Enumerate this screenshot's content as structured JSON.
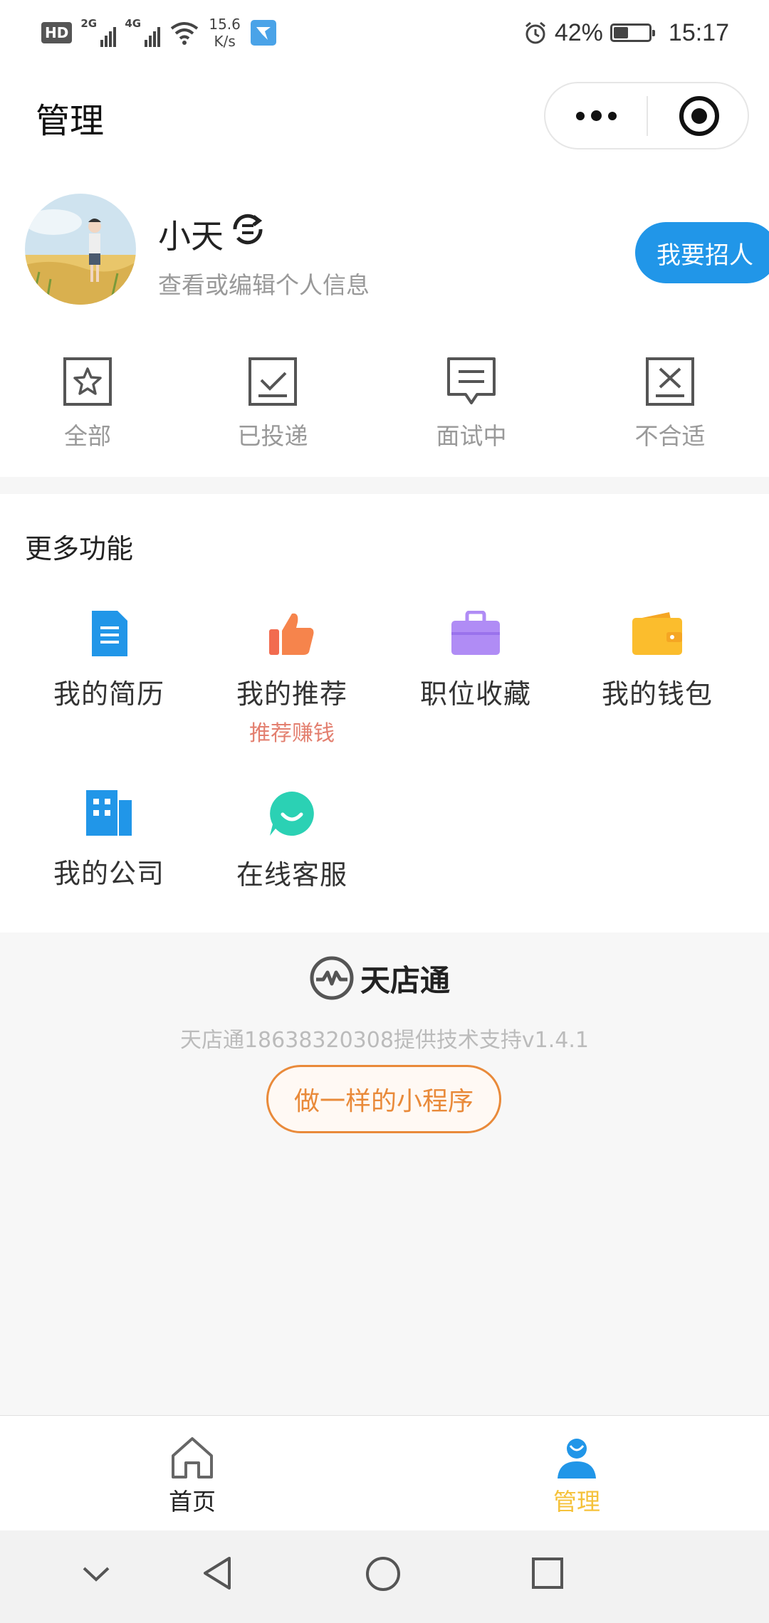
{
  "status_bar": {
    "hd": "HD",
    "sim1": "2G",
    "sim2": "4G",
    "speed_value": "15.6",
    "speed_unit": "K/s",
    "battery": "42%",
    "battery_level": 0.42,
    "time": "15:17"
  },
  "header": {
    "title": "管理"
  },
  "profile": {
    "name": "小天",
    "subtitle": "查看或编辑个人信息",
    "recruit_button": "我要招人"
  },
  "status_tabs": [
    {
      "label": "全部",
      "icon": "star-icon"
    },
    {
      "label": "已投递",
      "icon": "check-box-icon"
    },
    {
      "label": "面试中",
      "icon": "chat-bubble-icon"
    },
    {
      "label": "不合适",
      "icon": "x-box-icon"
    }
  ],
  "more_features": {
    "title": "更多功能",
    "items": [
      {
        "label": "我的简历",
        "icon": "resume-icon",
        "color": "#2196e8"
      },
      {
        "label": "我的推荐",
        "sublabel": "推荐赚钱",
        "icon": "thumbs-up-icon",
        "color": "#f26b4f"
      },
      {
        "label": "职位收藏",
        "icon": "briefcase-icon",
        "color": "#b08cf5"
      },
      {
        "label": "我的钱包",
        "icon": "wallet-icon",
        "color": "#fbbd2d"
      },
      {
        "label": "我的公司",
        "icon": "building-icon",
        "color": "#2196e8"
      },
      {
        "label": "在线客服",
        "icon": "chat-smile-icon",
        "color": "#2bd1b4"
      }
    ]
  },
  "footer": {
    "brand": "天店通",
    "support_text": "天店通18638320308提供技术支持v1.4.1",
    "make_button": "做一样的小程序"
  },
  "tabbar": {
    "items": [
      {
        "label": "首页",
        "icon": "home-icon",
        "active": false
      },
      {
        "label": "管理",
        "icon": "person-icon",
        "active": true
      }
    ],
    "active_color": "#f5c23b",
    "inactive_color": "#222222"
  },
  "colors": {
    "accent": "#2196e8",
    "brand_orange": "#e98a3a"
  }
}
